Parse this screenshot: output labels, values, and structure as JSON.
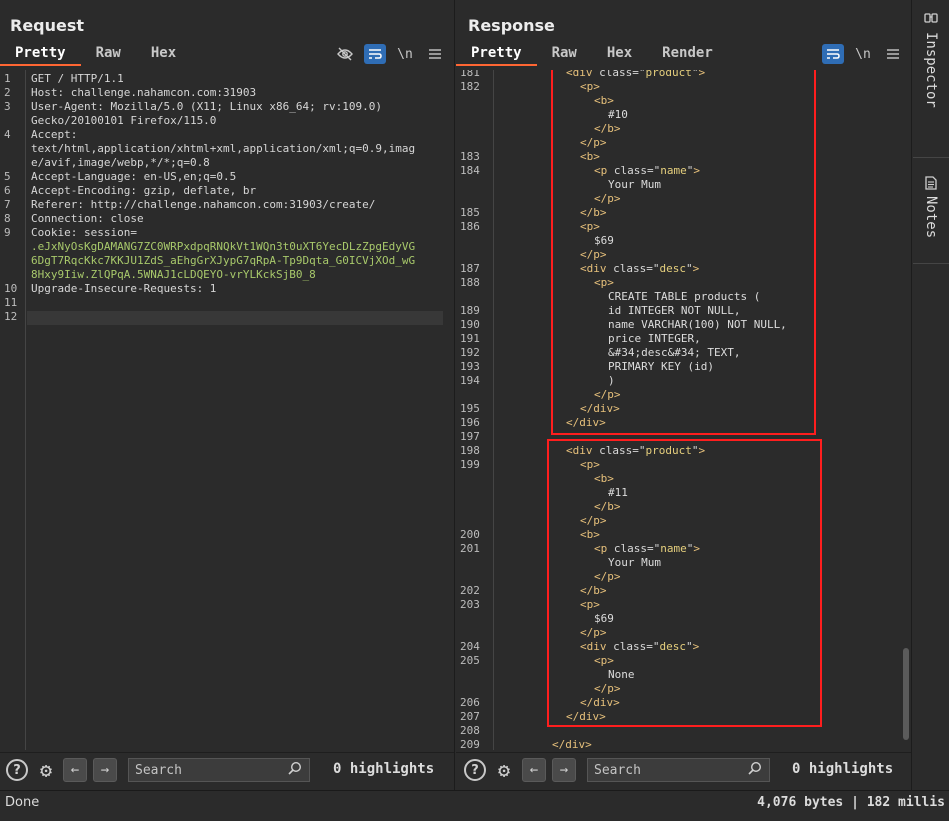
{
  "request": {
    "title": "Request",
    "tabs": [
      "Pretty",
      "Raw",
      "Hex"
    ],
    "active_tab": "Pretty",
    "icons": [
      "eye-off-icon",
      "wrap-icon",
      "newline-icon",
      "menu-icon"
    ],
    "newline_label": "\\n",
    "lines": [
      {
        "n": "1",
        "t": "GET / HTTP/1.1"
      },
      {
        "n": "2",
        "t": "Host: challenge.nahamcon.com:31903"
      },
      {
        "n": "3",
        "t": "User-Agent: Mozilla/5.0 (X11; Linux x86_64; rv:109.0)"
      },
      {
        "n": "",
        "t": "Gecko/20100101 Firefox/115.0"
      },
      {
        "n": "4",
        "t": "Accept:"
      },
      {
        "n": "",
        "t": "text/html,application/xhtml+xml,application/xml;q=0.9,imag"
      },
      {
        "n": "",
        "t": "e/avif,image/webp,*/*;q=0.8"
      },
      {
        "n": "5",
        "t": "Accept-Language: en-US,en;q=0.5"
      },
      {
        "n": "6",
        "t": "Accept-Encoding: gzip, deflate, br"
      },
      {
        "n": "7",
        "t": "Referer: http://challenge.nahamcon.com:31903/create/"
      },
      {
        "n": "8",
        "t": "Connection: close"
      },
      {
        "n": "9",
        "t": "Cookie: session="
      },
      {
        "n": "",
        "t": ".eJxNyOsKgDAMANG7ZC0WRPxdpqRNQkVt1WQn3t0uXT6YecDLzZpgEdyVG",
        "v": true
      },
      {
        "n": "",
        "t": "6DgT7RqcKkc7KKJU1ZdS_aEhgGrXJypG7qRpA-Tp9Dqta_G0ICVjXOd_wG",
        "v": true
      },
      {
        "n": "",
        "t": "8Hxy9Iiw.ZlQPqA.5WNAJ1cLDQEYO-vrYLKckSjB0_8",
        "v": true
      },
      {
        "n": "10",
        "t": "Upgrade-Insecure-Requests: 1"
      },
      {
        "n": "11",
        "t": ""
      },
      {
        "n": "12",
        "t": ""
      }
    ],
    "search_placeholder": "Search",
    "highlights": "0 highlights"
  },
  "response": {
    "title": "Response",
    "tabs": [
      "Pretty",
      "Raw",
      "Hex",
      "Render"
    ],
    "active_tab": "Pretty",
    "icons": [
      "wrap-icon",
      "newline-icon",
      "menu-icon"
    ],
    "newline_label": "\\n",
    "lines": [
      {
        "n": "181",
        "i": 1,
        "k": "open",
        "tag": "div",
        "attr": "class",
        "val": "product"
      },
      {
        "n": "182",
        "i": 2,
        "k": "open",
        "tag": "p"
      },
      {
        "n": "",
        "i": 3,
        "k": "open",
        "tag": "b"
      },
      {
        "n": "",
        "i": 4,
        "k": "text",
        "t": "#10"
      },
      {
        "n": "",
        "i": 3,
        "k": "close",
        "tag": "b"
      },
      {
        "n": "",
        "i": 2,
        "k": "close",
        "tag": "p"
      },
      {
        "n": "183",
        "i": 2,
        "k": "open",
        "tag": "b"
      },
      {
        "n": "184",
        "i": 3,
        "k": "open",
        "tag": "p",
        "attr": "class",
        "val": "name"
      },
      {
        "n": "",
        "i": 4,
        "k": "text",
        "t": "Your Mum"
      },
      {
        "n": "",
        "i": 3,
        "k": "close",
        "tag": "p"
      },
      {
        "n": "185",
        "i": 2,
        "k": "close",
        "tag": "b"
      },
      {
        "n": "186",
        "i": 2,
        "k": "open",
        "tag": "p"
      },
      {
        "n": "",
        "i": 3,
        "k": "text",
        "t": "$69"
      },
      {
        "n": "",
        "i": 2,
        "k": "close",
        "tag": "p"
      },
      {
        "n": "187",
        "i": 2,
        "k": "open",
        "tag": "div",
        "attr": "class",
        "val": "desc"
      },
      {
        "n": "188",
        "i": 3,
        "k": "open",
        "tag": "p"
      },
      {
        "n": "",
        "i": 4,
        "k": "text",
        "t": "CREATE TABLE products ("
      },
      {
        "n": "189",
        "i": 4,
        "k": "text",
        "t": "id INTEGER NOT NULL,"
      },
      {
        "n": "190",
        "i": 4,
        "k": "text",
        "t": "name VARCHAR(100) NOT NULL,"
      },
      {
        "n": "191",
        "i": 4,
        "k": "text",
        "t": "price INTEGER,"
      },
      {
        "n": "192",
        "i": 4,
        "k": "text",
        "t": "&#34;desc&#34; TEXT,"
      },
      {
        "n": "193",
        "i": 4,
        "k": "text",
        "t": "PRIMARY KEY (id)"
      },
      {
        "n": "194",
        "i": 4,
        "k": "text",
        "t": ")"
      },
      {
        "n": "",
        "i": 3,
        "k": "close",
        "tag": "p"
      },
      {
        "n": "195",
        "i": 2,
        "k": "close",
        "tag": "div"
      },
      {
        "n": "196",
        "i": 1,
        "k": "close",
        "tag": "div"
      },
      {
        "n": "197",
        "i": 0,
        "k": "text",
        "t": ""
      },
      {
        "n": "198",
        "i": 1,
        "k": "open",
        "tag": "div",
        "attr": "class",
        "val": "product"
      },
      {
        "n": "199",
        "i": 2,
        "k": "open",
        "tag": "p"
      },
      {
        "n": "",
        "i": 3,
        "k": "open",
        "tag": "b"
      },
      {
        "n": "",
        "i": 4,
        "k": "text",
        "t": "#11"
      },
      {
        "n": "",
        "i": 3,
        "k": "close",
        "tag": "b"
      },
      {
        "n": "",
        "i": 2,
        "k": "close",
        "tag": "p"
      },
      {
        "n": "200",
        "i": 2,
        "k": "open",
        "tag": "b"
      },
      {
        "n": "201",
        "i": 3,
        "k": "open",
        "tag": "p",
        "attr": "class",
        "val": "name"
      },
      {
        "n": "",
        "i": 4,
        "k": "text",
        "t": "Your Mum"
      },
      {
        "n": "",
        "i": 3,
        "k": "close",
        "tag": "p"
      },
      {
        "n": "202",
        "i": 2,
        "k": "close",
        "tag": "b"
      },
      {
        "n": "203",
        "i": 2,
        "k": "open",
        "tag": "p"
      },
      {
        "n": "",
        "i": 3,
        "k": "text",
        "t": "$69"
      },
      {
        "n": "",
        "i": 2,
        "k": "close",
        "tag": "p"
      },
      {
        "n": "204",
        "i": 2,
        "k": "open",
        "tag": "div",
        "attr": "class",
        "val": "desc"
      },
      {
        "n": "205",
        "i": 3,
        "k": "open",
        "tag": "p"
      },
      {
        "n": "",
        "i": 4,
        "k": "text",
        "t": "None"
      },
      {
        "n": "",
        "i": 3,
        "k": "close",
        "tag": "p"
      },
      {
        "n": "206",
        "i": 2,
        "k": "close",
        "tag": "div"
      },
      {
        "n": "207",
        "i": 1,
        "k": "close",
        "tag": "div"
      },
      {
        "n": "208",
        "i": 0,
        "k": "text",
        "t": ""
      },
      {
        "n": "209",
        "i": 0,
        "k": "close",
        "tag": "div"
      }
    ],
    "search_placeholder": "Search",
    "highlights": "0 highlights"
  },
  "status": {
    "left": "Done",
    "right": "4,076 bytes | 182 millis"
  },
  "side_tabs": [
    {
      "label": "Inspector",
      "icon": "inspector-icon"
    },
    {
      "label": "Notes",
      "icon": "notes-icon"
    }
  ],
  "colors": {
    "accent": "#ff6633",
    "active_button": "#2f6db5",
    "highlight_box": "#ff1e1e"
  }
}
